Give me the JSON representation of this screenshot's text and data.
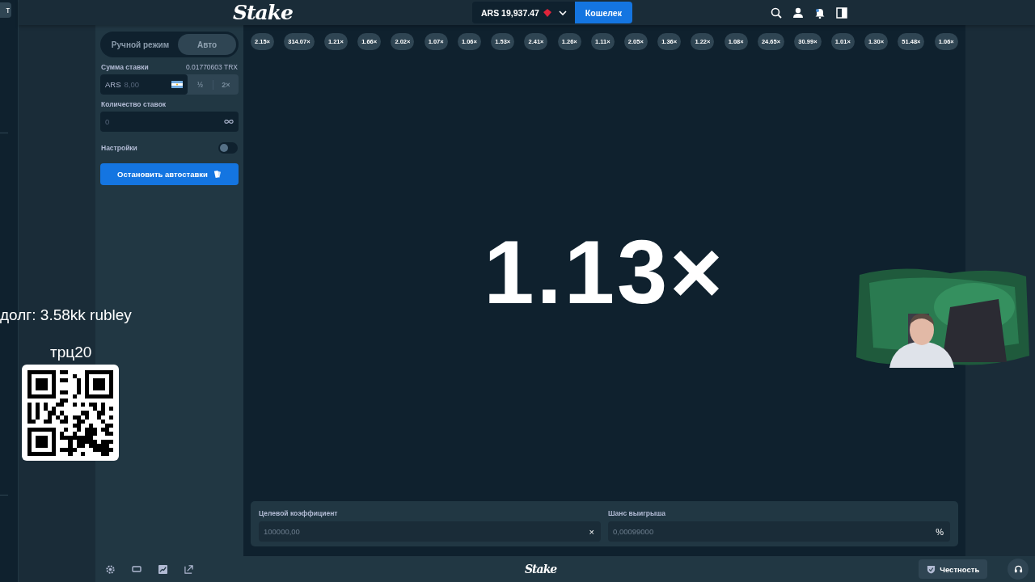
{
  "sidebar": {
    "button_text": "т"
  },
  "header": {
    "logo": "Stake",
    "balance": "ARS 19,937.47",
    "wallet_button": "Кошелек"
  },
  "bet_panel": {
    "tabs": [
      {
        "label": "Ручной режим",
        "selected": false
      },
      {
        "label": "Авто",
        "selected": true
      }
    ],
    "bet_amount": {
      "label": "Сумма ставки",
      "conversion": "0.01770603 TRX",
      "currency": "ARS",
      "value": "8,00",
      "buttons": [
        {
          "label": "½",
          "disabled": true
        },
        {
          "label": "2×",
          "disabled": true
        }
      ]
    },
    "bet_count": {
      "label": "Количество ставок",
      "value": "0"
    },
    "settings": {
      "label": "Настройки",
      "on": false
    },
    "stop_button": "Остановить автоставки"
  },
  "game": {
    "history": [
      "2.15×",
      "314.07×",
      "1.21×",
      "1.66×",
      "2.02×",
      "1.07×",
      "1.06×",
      "1.53×",
      "2.41×",
      "1.26×",
      "1.11×",
      "2.05×",
      "1.36×",
      "1.22×",
      "1.08×",
      "24.65×",
      "30.99×",
      "1.01×",
      "1.30×",
      "51.48×",
      "1.06×"
    ],
    "multiplier": "1.13×",
    "target": {
      "label": "Целевой коэффициент",
      "value": "100000,00",
      "suffix": "×"
    },
    "win_chance": {
      "label": "Шанс выигрыша",
      "value": "0,00099000",
      "suffix": "%"
    }
  },
  "footer": {
    "logo": "Stake",
    "fairness_button": "Честность"
  },
  "overlay": {
    "debt": "долг: 3.58kk rubley",
    "qr_caption": "трц20"
  }
}
